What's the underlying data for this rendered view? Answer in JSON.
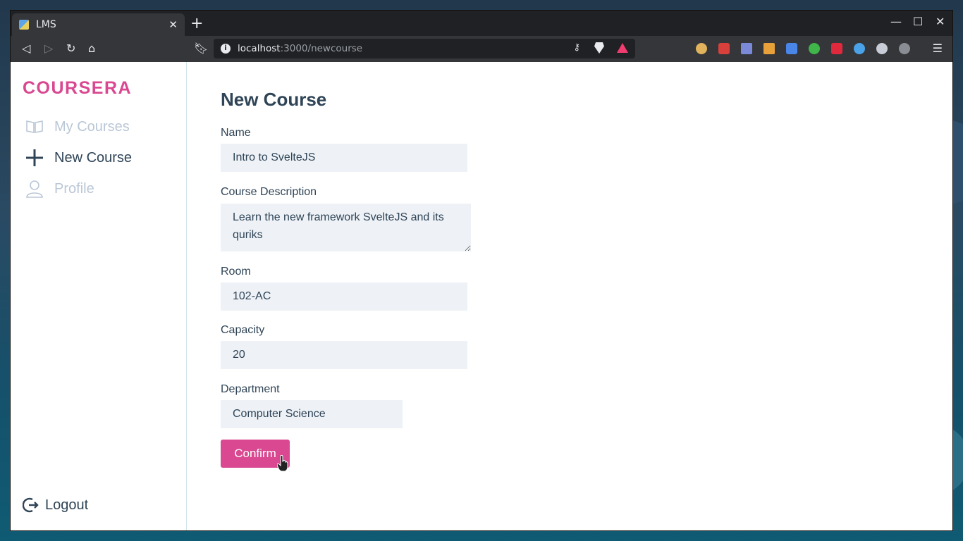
{
  "browser": {
    "tab_title": "LMS",
    "url_host": "localhost",
    "url_path": ":3000/newcourse"
  },
  "sidebar": {
    "brand": "COURSERA",
    "items": [
      {
        "label": "My Courses",
        "icon": "book-open-icon",
        "state": "inactive"
      },
      {
        "label": "New Course",
        "icon": "plus-icon",
        "state": "active"
      },
      {
        "label": "Profile",
        "icon": "user-icon",
        "state": "inactive"
      }
    ],
    "logout_label": "Logout"
  },
  "form": {
    "title": "New Course",
    "name_label": "Name",
    "name_value": "Intro to SvelteJS",
    "description_label": "Course Description",
    "description_value": "Learn the new framework SvelteJS and its quriks",
    "room_label": "Room",
    "room_value": "102-AC",
    "capacity_label": "Capacity",
    "capacity_value": "20",
    "department_label": "Department",
    "department_value": "Computer Science",
    "confirm_label": "Confirm"
  },
  "colors": {
    "accent": "#d94890",
    "text": "#2f4456",
    "muted": "#bac7d6",
    "input_bg": "#eef2f7"
  }
}
